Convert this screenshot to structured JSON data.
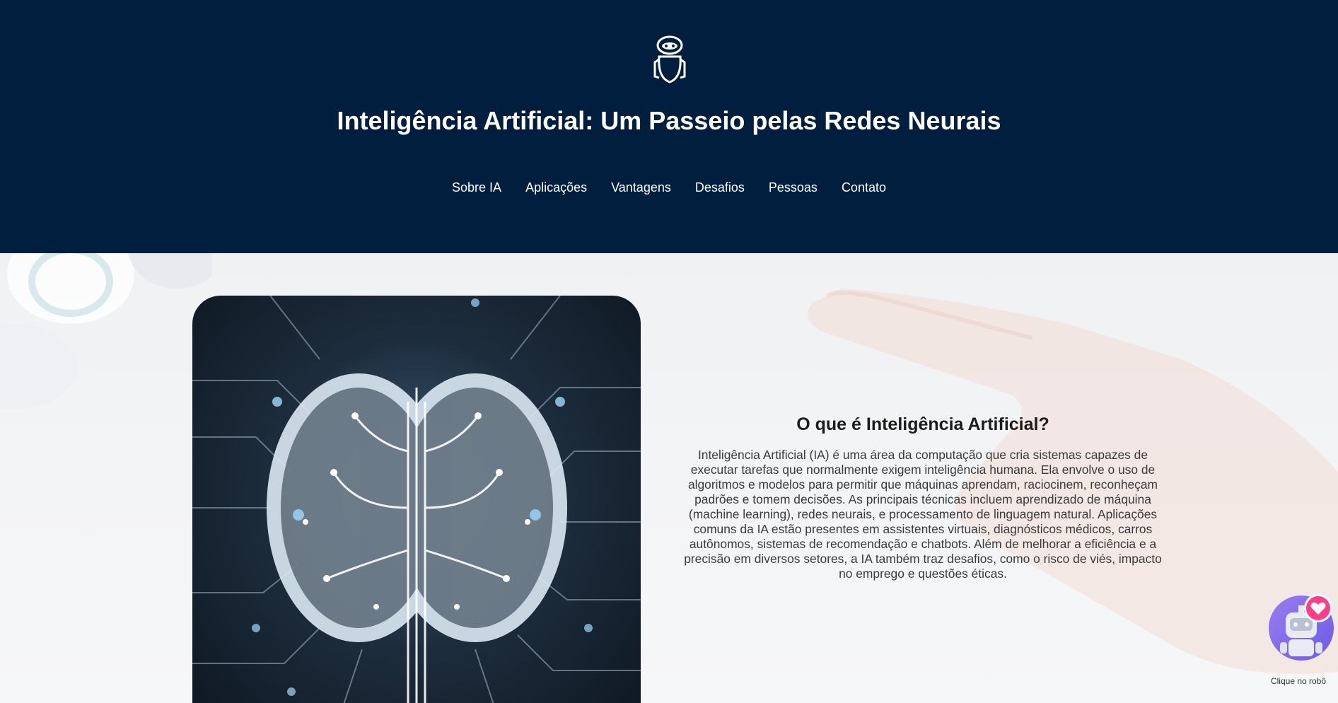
{
  "header": {
    "logo_icon": "robot-icon",
    "title": "Inteligência Artificial: Um Passeio pelas Redes Neurais",
    "nav": [
      {
        "label": "Sobre IA"
      },
      {
        "label": "Aplicações"
      },
      {
        "label": "Vantagens"
      },
      {
        "label": "Desafios"
      },
      {
        "label": "Pessoas"
      },
      {
        "label": "Contato"
      }
    ]
  },
  "about": {
    "image_icon": "circuit-brain-image",
    "heading": "O que é Inteligência Artificial?",
    "body": "Inteligência Artificial (IA) é uma área da computação que cria sistemas capazes de executar tarefas que normalmente exigem inteligência humana. Ela envolve o uso de algoritmos e modelos para permitir que máquinas aprendam, raciocinem, reconheçam padrões e tomem decisões. As principais técnicas incluem aprendizado de máquina (machine learning), redes neurais, e processamento de linguagem natural. Aplicações comuns da IA estão presentes em assistentes virtuais, diagnósticos médicos, carros autônomos, sistemas de recomendação e chatbots. Além de melhorar a eficiência e a precisão em diversos setores, a IA também traz desafios, como o risco de viés, impacto no emprego e questões éticas."
  },
  "chat_widget": {
    "icon": "robot-avatar-icon",
    "badge_icon": "heart-icon",
    "label": "Clique no robô"
  },
  "colors": {
    "header_bg": "#001f3f",
    "widget_purple": "#7b68ee",
    "heart_pink": "#ff3d8a"
  }
}
